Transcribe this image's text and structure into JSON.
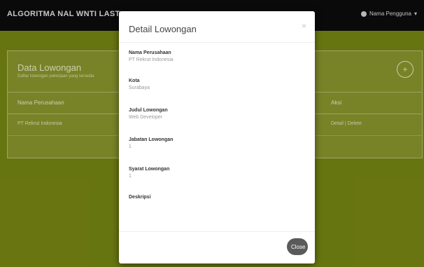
{
  "navbar": {
    "brand": "ALGORITMA NAL WNTI LAST",
    "user": "Nama Pengguna"
  },
  "panel": {
    "title": "Data Lowongan",
    "subtitle": "Daftar lowongan pekerjaan yang tersedia",
    "add_label": "+",
    "columns": [
      "Nama Perusahaan",
      "Aksi"
    ],
    "rows": [
      {
        "company": "PT Rekrut Indonesia",
        "action": "Detail | Delete"
      }
    ]
  },
  "modal": {
    "title": "Detail Lowongan",
    "close_x": "×",
    "fields": [
      {
        "label": "Nama Perusahaan",
        "value": "PT Rekrut Indonesia"
      },
      {
        "label": "Kota",
        "value": "Surabaya"
      },
      {
        "label": "Judul Lowongan",
        "value": "Web Developer"
      },
      {
        "label": "Jabatan Lowongan",
        "value": "1"
      },
      {
        "label": "Syarat Lowongan",
        "value": "1"
      },
      {
        "label": "Deskripsi",
        "value": ""
      }
    ],
    "close_button": "Close"
  }
}
